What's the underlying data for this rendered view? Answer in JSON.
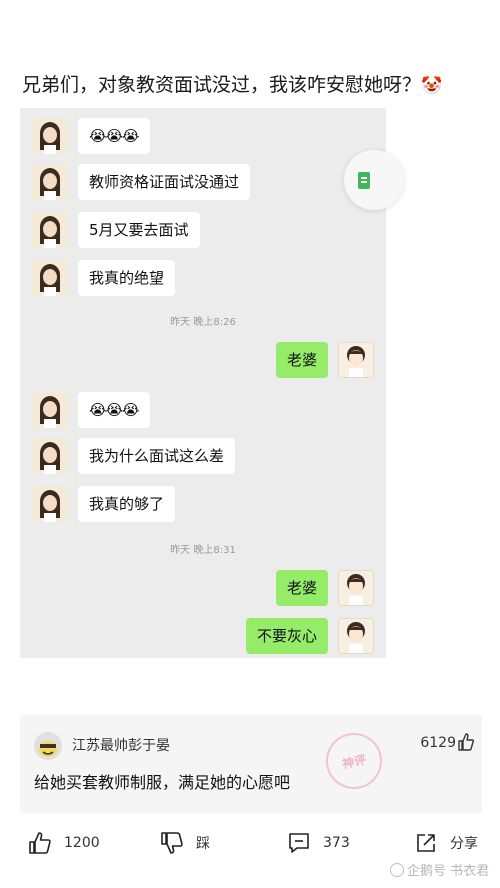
{
  "post": {
    "title": "兄弟们，对象教资面试没过，我该咋安慰她呀？",
    "title_emoji": "🤡"
  },
  "chat": {
    "messages": [
      {
        "side": "left",
        "text": "😭😭😭",
        "avatar": "girl-avatar"
      },
      {
        "side": "left",
        "text": "教师资格证面试没通过",
        "avatar": "girl-avatar"
      },
      {
        "side": "left",
        "text": "5月又要去面试",
        "avatar": "girl-avatar"
      },
      {
        "side": "left",
        "text": "我真的绝望",
        "avatar": "girl-avatar"
      },
      {
        "side": "time",
        "text": "昨天 晚上8:26"
      },
      {
        "side": "right",
        "text": "老婆",
        "avatar": "boy-avatar"
      },
      {
        "side": "left",
        "text": "😭😭😭",
        "avatar": "girl-avatar"
      },
      {
        "side": "left",
        "text": "我为什么面试这么差",
        "avatar": "girl-avatar"
      },
      {
        "side": "left",
        "text": "我真的够了",
        "avatar": "girl-avatar"
      },
      {
        "side": "time",
        "text": "昨天 晚上8:31"
      },
      {
        "side": "right",
        "text": "老婆",
        "avatar": "boy-avatar"
      },
      {
        "side": "right",
        "text": "不要灰心",
        "avatar": "boy-avatar"
      }
    ],
    "colors": {
      "background": "#ececec",
      "sent_bubble": "#95ec69",
      "received_bubble": "#ffffff"
    }
  },
  "comment": {
    "user": "江苏最帅彭于晏",
    "likes": "6129",
    "text": "给她买套教师制服，满足她的心愿吧",
    "stamp": "神评"
  },
  "actions": {
    "like_count": "1200",
    "dislike_label": "踩",
    "comment_count": "373",
    "share_label": "分享"
  },
  "watermark": "企鹅号 书衣君"
}
